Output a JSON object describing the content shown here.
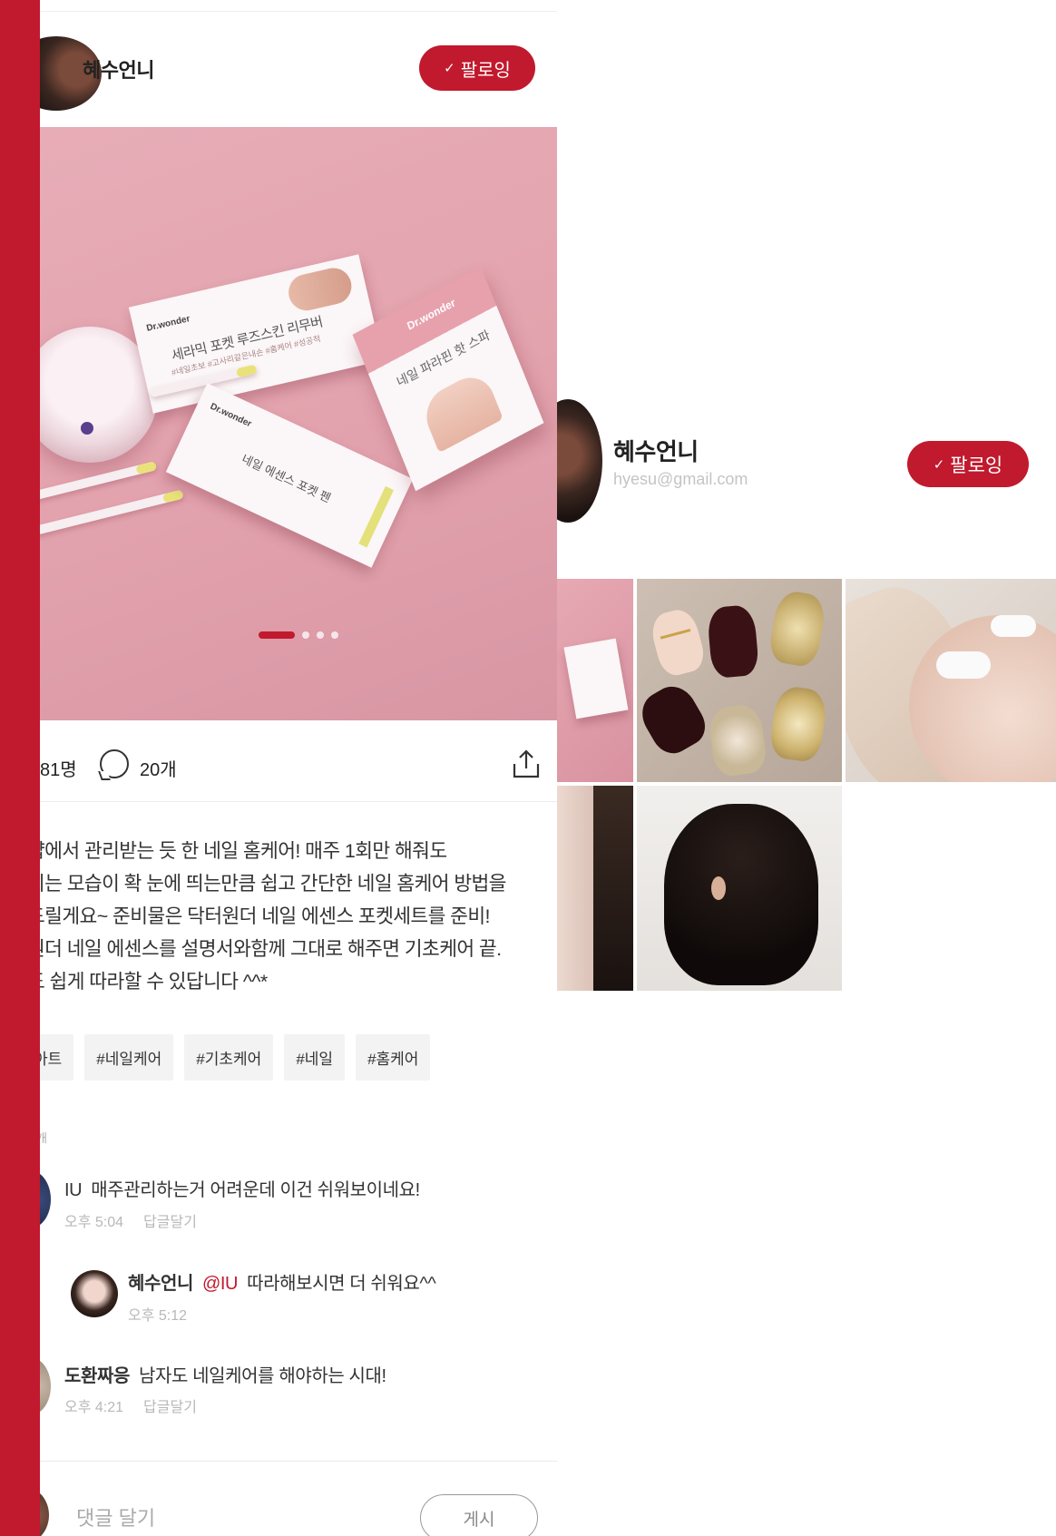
{
  "post": {
    "username": "혜수언니",
    "follow_label": "팔로잉",
    "image_dots": 4,
    "image_active_index": 0,
    "likes_text": "81명",
    "comments_text": "20개",
    "caption_lines": [
      "샵에서 관리받는 듯 한 네일 홈케어! 매주 1회만 해줘도",
      "되는 모습이 확 눈에 띄는만큼 쉽고 간단한 네일 홈케어 방법을",
      "드릴게요~ 준비물은 닥터원더 네일 에센스 포켓세트를 준비!",
      "원더 네일 에센스를 설명서와함께 그대로 해주면 기초케어 끝.",
      "도 쉽게 따라할 수 있답니다 ^^*"
    ],
    "tags": [
      "아트",
      "#네일케어",
      "#기초케어",
      "#네일",
      "#홈케어"
    ],
    "comments_count_text": "개",
    "comments": [
      {
        "author": "IU",
        "mention": "",
        "text": "매주관리하는거 어려운데 이건 쉬워보이네요!",
        "time": "오후 5:04",
        "reply_label": "답글달기"
      },
      {
        "author": "혜수언니",
        "mention": "@IU",
        "text": "따라해보시면 더 쉬워요^^",
        "time": "오후 5:12",
        "reply_label": ""
      },
      {
        "author": "도환짜응",
        "mention": "",
        "text": "남자도 네일케어를 해야하는 시대!",
        "time": "오후 4:21",
        "reply_label": "답글달기"
      }
    ],
    "comment_input_placeholder": "댓글 달기",
    "post_button_label": "게시",
    "image_text": {
      "card1_brand": "Dr.wonder",
      "card1_title": "세라믹 포켓 루즈스킨 리무버",
      "card1_tags": "#네일초보 #고사리같은내손 #홈케어 #성공적",
      "card2_brand": "Dr.wonder",
      "card2_title": "네일 에센스 포켓 펜",
      "box_brand": "Dr.wonder",
      "box_title": "네일 파라핀 핫 스파"
    }
  },
  "profile": {
    "name": "혜수언니",
    "email": "hyesu@gmail.com",
    "follow_label": "팔로잉"
  },
  "colors": {
    "accent": "#c1192d",
    "hero_pink": "#e3a3ae",
    "tag_bg": "#f3f3f3",
    "meta_gray": "#b8b8b8"
  }
}
